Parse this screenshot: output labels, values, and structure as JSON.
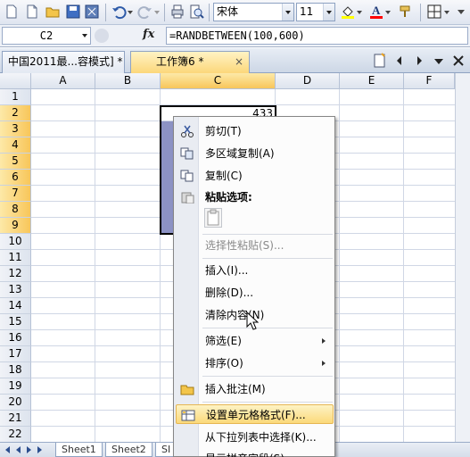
{
  "toolbar": {
    "font_name": "宋体",
    "font_size": "11",
    "font_color": "#ff0000",
    "highlight_color": "#ffff00"
  },
  "formula_bar": {
    "cell_ref": "C2",
    "fx_label": "fx",
    "formula": "=RANDBETWEEN(100,600)"
  },
  "doc_tabs": [
    {
      "label": "中国2011最...容模式] *",
      "active": false
    },
    {
      "label": "工作簿6 *",
      "active": true,
      "close": "×"
    }
  ],
  "grid": {
    "columns": [
      "A",
      "B",
      "C",
      "D",
      "E",
      "F"
    ],
    "selected_column": "C",
    "rows": [
      "1",
      "2",
      "3",
      "4",
      "5",
      "6",
      "7",
      "8",
      "9",
      "10",
      "11",
      "12",
      "13",
      "14",
      "15",
      "16",
      "17",
      "18",
      "19",
      "20",
      "21",
      "22"
    ],
    "selected_rows": [
      "2",
      "3",
      "4",
      "5",
      "6",
      "7",
      "8",
      "9"
    ],
    "cell_C2": "433"
  },
  "sheet_tabs": [
    "Sheet1",
    "Sheet2",
    "SI"
  ],
  "context_menu": {
    "items": [
      {
        "label": "剪切(T)",
        "icon": "scissors-icon"
      },
      {
        "label": "多区域复制(A)",
        "icon": "multi-copy-icon"
      },
      {
        "label": "复制(C)",
        "icon": "copy-icon"
      },
      {
        "label": "粘贴选项:",
        "icon": "paste-icon"
      },
      {
        "label": "选择性粘贴(S)...",
        "disabled": true
      },
      {
        "label": "插入(I)..."
      },
      {
        "label": "删除(D)..."
      },
      {
        "label": "清除内容(N)"
      },
      {
        "label": "筛选(E)",
        "submenu": true
      },
      {
        "label": "排序(O)",
        "submenu": true
      },
      {
        "label": "插入批注(M)",
        "icon": "comment-icon"
      },
      {
        "label": "设置单元格格式(F)...",
        "icon": "format-cells-icon",
        "highlighted": true
      },
      {
        "label": "从下拉列表中选择(K)..."
      },
      {
        "label": "显示拼音字段(S)"
      }
    ]
  },
  "colors": {
    "selection_header": "#f8c65a",
    "menu_highlight": "#fbd97a",
    "selection_fill": "#8c92c4"
  }
}
